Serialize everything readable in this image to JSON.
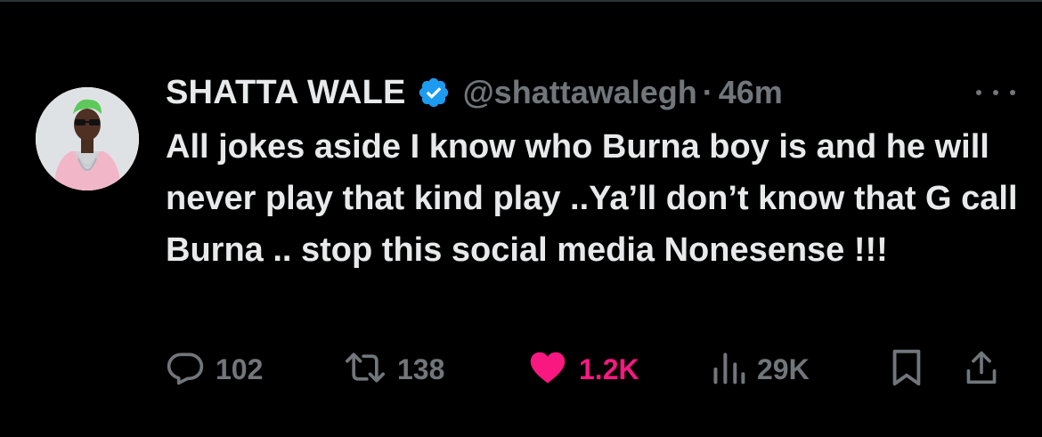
{
  "tweet": {
    "author": {
      "display_name": "SHATTA WALE",
      "handle": "@shattawalegh",
      "verified": true,
      "avatar_icon": "profile-photo"
    },
    "separator": "·",
    "time": "46m",
    "more_icon": "ellipsis-icon",
    "text": "All jokes aside I know who Burna boy is and he will never play that kind play ..Ya’ll don’t know that G call Burna .. stop this social media Nonesense !!!",
    "actions": {
      "reply": {
        "icon": "reply-icon",
        "count": "102"
      },
      "retweet": {
        "icon": "retweet-icon",
        "count": "138"
      },
      "like": {
        "icon": "heart-icon",
        "count": "1.2K",
        "active": true
      },
      "views": {
        "icon": "views-icon",
        "count": "29K"
      },
      "bookmark": {
        "icon": "bookmark-icon"
      },
      "share": {
        "icon": "share-icon"
      }
    }
  },
  "colors": {
    "background": "#000000",
    "text_primary": "#e7e9ea",
    "text_secondary": "#71767b",
    "verified_blue": "#1d9bf0",
    "like_pink": "#f91880"
  }
}
